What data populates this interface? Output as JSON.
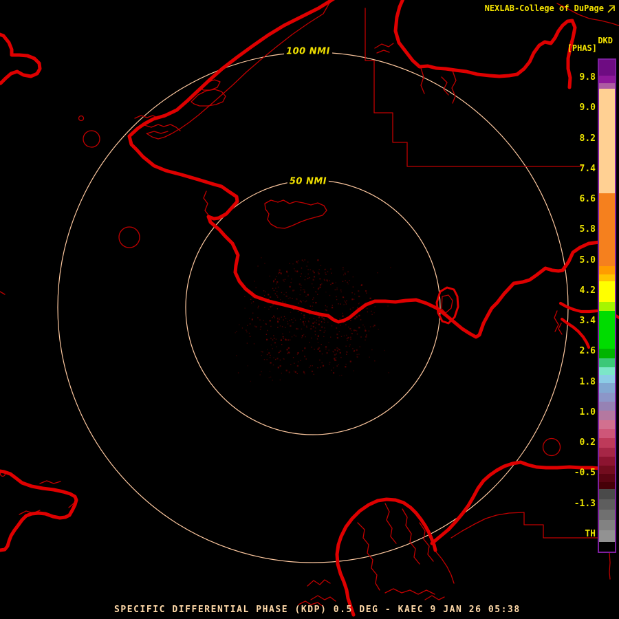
{
  "header": {
    "brand": "NEXLAB-College of DuPage",
    "product_id": "DKD",
    "product_units": "[PHAS]"
  },
  "range_rings": [
    {
      "label": "100 NMI"
    },
    {
      "label": "50 NMI"
    }
  ],
  "colorbar": {
    "tick_labels": [
      "9.8",
      "9.0",
      "8.2",
      "7.4",
      "6.6",
      "5.8",
      "5.0",
      "4.2",
      "3.4",
      "2.6",
      "1.8",
      "1.0",
      "0.2",
      "-0.5",
      "-1.3",
      "TH"
    ],
    "segments": [
      [
        "#6E0C82",
        23
      ],
      [
        "#8E189A",
        11
      ],
      [
        "#AE5CA2",
        8
      ],
      [
        "#FFD093",
        152
      ],
      [
        "#F5801E",
        106
      ],
      [
        "#FF9C00",
        12
      ],
      [
        "#FFC400",
        10
      ],
      [
        "#FFFF00",
        30
      ],
      [
        "#A6F500",
        13
      ],
      [
        "#00DC00",
        55
      ],
      [
        "#00B400",
        14
      ],
      [
        "#3CC878",
        13
      ],
      [
        "#7CE6C8",
        11
      ],
      [
        "#8CCCE6",
        12
      ],
      [
        "#82A8D2",
        14
      ],
      [
        "#8C96C8",
        13
      ],
      [
        "#9682B4",
        13
      ],
      [
        "#B478A0",
        14
      ],
      [
        "#D2708F",
        13
      ],
      [
        "#CE5678",
        13
      ],
      [
        "#BE3A5A",
        14
      ],
      [
        "#A62646",
        13
      ],
      [
        "#8C1430",
        13
      ],
      [
        "#720C1E",
        12
      ],
      [
        "#5A0412",
        12
      ],
      [
        "#460008",
        10
      ],
      [
        "#4A4A4A",
        15
      ],
      [
        "#5E5E5E",
        15
      ],
      [
        "#707070",
        15
      ],
      [
        "#828282",
        15
      ],
      [
        "#929292",
        17
      ],
      [
        "#000000",
        14
      ]
    ]
  },
  "status_bar": {
    "text": "SPECIFIC DIFFERENTIAL PHASE (KDP) 0.5 DEG - KAEC 9 JAN 26 05:38"
  },
  "colors": {
    "background": "#000000",
    "map_thick": "#DE0000",
    "map_thin": "#C00000",
    "ring": "#FFC9A0",
    "ring_label": "#F0E000",
    "header_text": "#F5E400",
    "status_text": "#FFD9A8",
    "colorbar_label": "#EDE400",
    "colorbar_border": "#7D1FA0",
    "echo": "#5C0000"
  }
}
